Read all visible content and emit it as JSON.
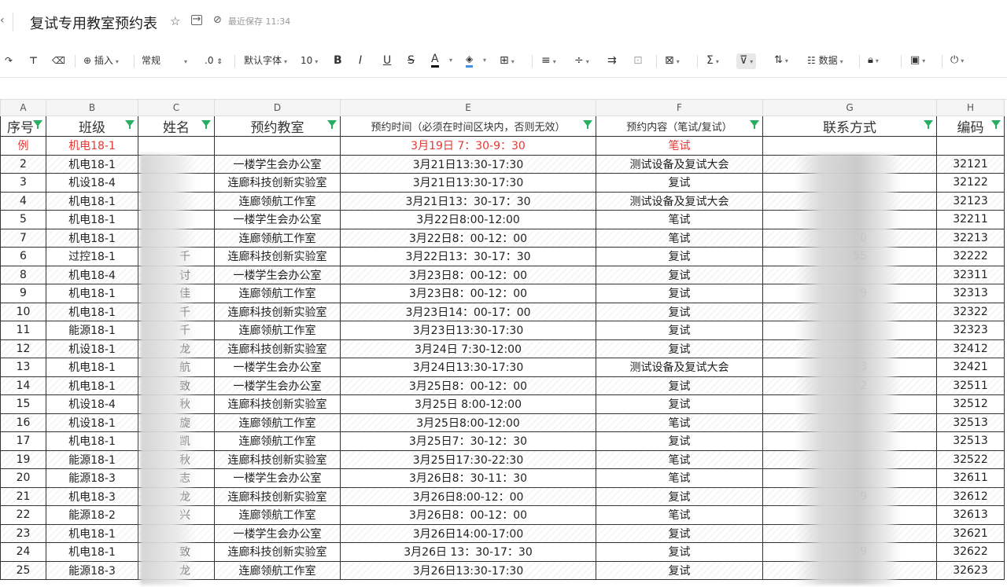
{
  "header": {
    "title": "复试专用教室预约表",
    "save_status": "最近保存 11:34",
    "icons": [
      "back-icon",
      "star-icon",
      "move-icon",
      "save-check-icon"
    ]
  },
  "toolbar": {
    "insert_label": "插入",
    "format_label": "常规",
    "decimal_label": ".0",
    "font_label": "默认字体",
    "font_size": "10",
    "bold": "B",
    "italic": "I",
    "underline": "U",
    "strike": "S",
    "font_color": "A",
    "data_label": "数据"
  },
  "columns": [
    "A",
    "B",
    "C",
    "D",
    "E",
    "F",
    "G",
    "H"
  ],
  "fields": {
    "seq": "序号",
    "class": "班级",
    "name": "姓名",
    "room": "预约教室",
    "time": "预约时间（必须在时间区块内，否则无效）",
    "content": "预约内容（笔试/复试）",
    "contact": "联系方式",
    "code": "编码"
  },
  "rows": [
    {
      "seq": "例",
      "class": "机电18-1",
      "room": "",
      "time": "3月19日  7：30-9：30",
      "content": "笔试",
      "code": "",
      "example": true
    },
    {
      "seq": "2",
      "class": "机电18-1",
      "room": "一楼学生会办公室",
      "time": "3月21日13:30-17:30",
      "content": "测试设备及复试大会",
      "code": "32121"
    },
    {
      "seq": "3",
      "class": "机设18-4",
      "room": "连廊科技创新实验室",
      "time": "3月21日13:30-17:30",
      "content": "复试",
      "code": "32122"
    },
    {
      "seq": "4",
      "class": "机电18-1",
      "room": "连廊领航工作室",
      "time": "3月21日13：30-17：30",
      "content": "测试设备及复试大会",
      "code": "32123"
    },
    {
      "seq": "5",
      "class": "机电18-1",
      "room": "一楼学生会办公室",
      "time": "3月22日8:00-12:00",
      "content": "笔试",
      "code": "32211"
    },
    {
      "seq": "7",
      "class": "机电18-1",
      "room": "连廊领航工作室",
      "time": "3月22日8：00-12：00",
      "content": "笔试",
      "code": "32213"
    },
    {
      "seq": "6",
      "class": "过控18-1",
      "room": "连廊科技创新实验室",
      "time": "3月22日13：30-17：30",
      "content": "复试",
      "code": "32222"
    },
    {
      "seq": "8",
      "class": "机电18-4",
      "room": "一楼学生会办公室",
      "time": "3月23日8：00-12：00",
      "content": "复试",
      "code": "32311"
    },
    {
      "seq": "9",
      "class": "机电18-1",
      "room": "连廊领航工作室",
      "time": "3月23日8：00-12：00",
      "content": "复试",
      "code": "32313"
    },
    {
      "seq": "10",
      "class": "机电18-1",
      "room": "连廊科技创新实验室",
      "time": "3月23日14：00-17：00",
      "content": "复试",
      "code": "32322"
    },
    {
      "seq": "11",
      "class": "能源18-1",
      "room": "连廊领航工作室",
      "time": "3月23日13:30-17:30",
      "content": "复试",
      "code": "32323"
    },
    {
      "seq": "12",
      "class": "机设18-1",
      "room": "连廊科技创新实验室",
      "time": "3月24日  7:30-12:00",
      "content": "复试",
      "code": "32412"
    },
    {
      "seq": "13",
      "class": "机电18-1",
      "room": "一楼学生会办公室",
      "time": "3月24日13:30-17:30",
      "content": "测试设备及复试大会",
      "code": "32421"
    },
    {
      "seq": "14",
      "class": "机电18-1",
      "room": "一楼学生会办公室",
      "time": "3月25日8：00-12：00",
      "content": "复试",
      "code": "32511"
    },
    {
      "seq": "15",
      "class": "机设18-4",
      "room": "连廊科技创新实验室",
      "time": "3月25日  8:00-12:00",
      "content": "复试",
      "code": "32512"
    },
    {
      "seq": "16",
      "class": "机设18-1",
      "room": "连廊领航工作室",
      "time": "3月25日8:00-12:00",
      "content": "笔试",
      "code": "32513"
    },
    {
      "seq": "17",
      "class": "机电18-1",
      "room": "连廊领航工作室",
      "time": "3月25日7：30-12：30",
      "content": "复试",
      "code": "32513"
    },
    {
      "seq": "19",
      "class": "能源18-1",
      "room": "连廊科技创新实验室",
      "time": "3月25日17:30-22:30",
      "content": "笔试",
      "code": "32522"
    },
    {
      "seq": "20",
      "class": "能源18-3",
      "room": "一楼学生会办公室",
      "time": "3月26日8：30-11：30",
      "content": "笔试",
      "code": "32611"
    },
    {
      "seq": "21",
      "class": "机电18-3",
      "room": "连廊科技创新实验室",
      "time": "3月26日8:00-12：00",
      "content": "复试",
      "code": "32612"
    },
    {
      "seq": "22",
      "class": "能源18-2",
      "room": "连廊领航工作室",
      "time": "3月26日8：00-12：00",
      "content": "笔试",
      "code": "32613"
    },
    {
      "seq": "23",
      "class": "机电18-1",
      "room": "一楼学生会办公室",
      "time": "3月26日14:00-17:00",
      "content": "复试",
      "code": "32621"
    },
    {
      "seq": "24",
      "class": "机电18-1",
      "room": "连廊科技创新实验室",
      "time": "3月26日 13：30-17：30",
      "content": "复试",
      "code": "32622"
    },
    {
      "seq": "25",
      "class": "能源18-3",
      "room": "连廊领航工作室",
      "time": "3月26日13:30-17:30",
      "content": "复试",
      "code": "32623"
    }
  ],
  "name_fragments": [
    "",
    "",
    "",
    "",
    "",
    "",
    "千",
    "讨",
    "佳",
    "千",
    "千",
    "龙",
    "航",
    "致",
    "秋",
    "旋",
    "凯",
    "秋",
    "志",
    "龙",
    "兴",
    "",
    "致",
    "龙",
    ""
  ],
  "contact_fragments": [
    "",
    "",
    "",
    "",
    "0",
    "55",
    "",
    "9",
    "",
    "",
    "",
    "3",
    "2",
    "",
    "",
    "",
    "",
    "",
    "9",
    "",
    "",
    "9",
    "",
    ""
  ],
  "colors": {
    "filter_icon": "#27ae60",
    "example_text": "#e53935",
    "grid_line": "#333333"
  }
}
